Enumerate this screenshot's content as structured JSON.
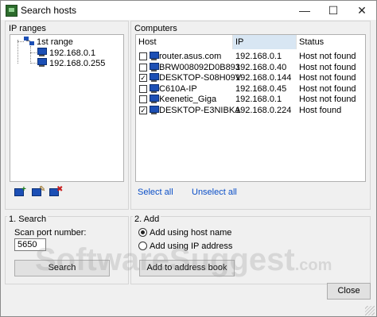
{
  "window": {
    "title": "Search hosts"
  },
  "window_controls": {
    "minimize": "—",
    "maximize": "☐",
    "close": "✕"
  },
  "ip_ranges": {
    "label": "IP ranges",
    "tree": {
      "root": "1st range",
      "children": [
        "192.168.0.1",
        "192.168.0.255"
      ]
    },
    "toolbar": [
      {
        "icon": "add-range-icon",
        "badge": "+"
      },
      {
        "icon": "edit-range-icon",
        "badge": "✎"
      },
      {
        "icon": "delete-range-icon",
        "badge": "✖"
      }
    ]
  },
  "computers": {
    "label": "Computers",
    "columns": [
      "Host",
      "IP",
      "Status"
    ],
    "rows": [
      {
        "checked": false,
        "host": "router.asus.com",
        "ip": "192.168.0.1",
        "status": "Host not found"
      },
      {
        "checked": false,
        "host": "BRW008092D0B893",
        "ip": "192.168.0.40",
        "status": "Host not found"
      },
      {
        "checked": true,
        "host": "DESKTOP-S08H09V",
        "ip": "192.168.0.144",
        "status": "Host not found"
      },
      {
        "checked": false,
        "host": "C610A-IP",
        "ip": "192.168.0.45",
        "status": "Host not found"
      },
      {
        "checked": false,
        "host": "Keenetic_Giga",
        "ip": "192.168.0.1",
        "status": "Host not found"
      },
      {
        "checked": true,
        "host": "DESKTOP-E3NIBKA",
        "ip": "192.168.0.224",
        "status": "Host found"
      }
    ],
    "select_all": "Select all",
    "unselect_all": "Unselect all"
  },
  "search": {
    "label": "1. Search",
    "port_label": "Scan port number:",
    "port_value": "5650",
    "button": "Search"
  },
  "add": {
    "label": "2. Add",
    "options": [
      {
        "label": "Add using host name",
        "selected": true
      },
      {
        "label": "Add using IP address",
        "selected": false
      }
    ],
    "button": "Add to address book"
  },
  "close_button": "Close",
  "watermark": {
    "main": "SoftwareSuggest",
    "suffix": ".com"
  },
  "colors": {
    "link": "#0a4ec7",
    "selected_header": "#d8e6f3",
    "icon_blue": "#1c4fb5"
  }
}
